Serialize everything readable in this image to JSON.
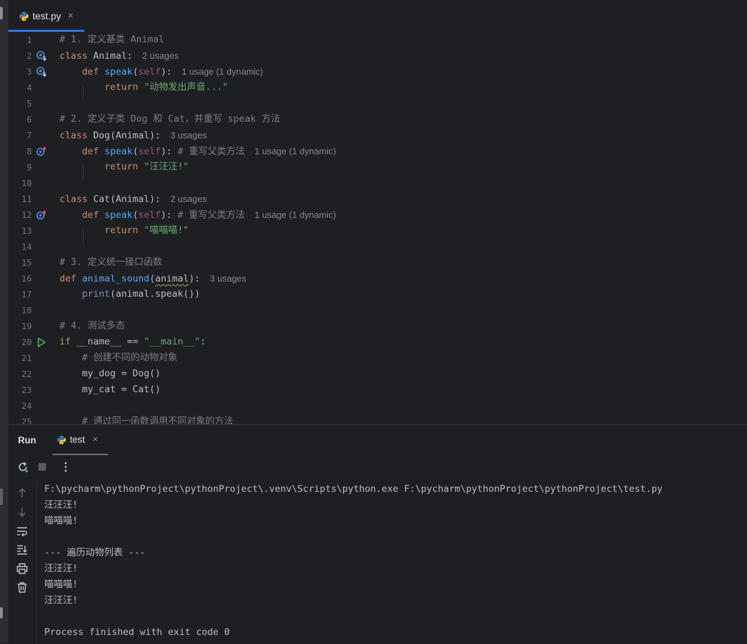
{
  "editor": {
    "tab": {
      "filename": "test.py",
      "close": "×"
    },
    "lines": [
      {
        "n": "1"
      },
      {
        "n": "2"
      },
      {
        "n": "3"
      },
      {
        "n": "4"
      },
      {
        "n": "5"
      },
      {
        "n": "6"
      },
      {
        "n": "7"
      },
      {
        "n": "8"
      },
      {
        "n": "9"
      },
      {
        "n": "10"
      },
      {
        "n": "11"
      },
      {
        "n": "12"
      },
      {
        "n": "13"
      },
      {
        "n": "14"
      },
      {
        "n": "15"
      },
      {
        "n": "16"
      },
      {
        "n": "17"
      },
      {
        "n": "18"
      },
      {
        "n": "19"
      },
      {
        "n": "20"
      },
      {
        "n": "21"
      },
      {
        "n": "22"
      },
      {
        "n": "23"
      },
      {
        "n": "24"
      },
      {
        "n": "25"
      }
    ],
    "code": {
      "l1_comment": "# 1. 定义基类 Animal",
      "l2_kw": "class",
      "l2_rest": " Animal:",
      "l2_hint": "2 usages",
      "l3_kw": "def",
      "l3_fn": "speak",
      "l3_self": "self",
      "l3_hint": "1 usage (1 dynamic)",
      "l4_kw": "return",
      "l4_str": "\"动物发出声音...\"",
      "l6_comment": "# 2. 定义子类 Dog 和 Cat，并重写 speak 方法",
      "l7_kw": "class",
      "l7_rest": " Dog(Animal):",
      "l7_hint": "3 usages",
      "l8_kw": "def",
      "l8_fn": "speak",
      "l8_self": "self",
      "l8_comment": "# 重写父类方法",
      "l8_hint": "1 usage (1 dynamic)",
      "l9_kw": "return",
      "l9_str": "\"汪汪汪!\"",
      "l11_kw": "class",
      "l11_rest": " Cat(Animal):",
      "l11_hint": "2 usages",
      "l12_kw": "def",
      "l12_fn": "speak",
      "l12_self": "self",
      "l12_comment": "# 重写父类方法",
      "l12_hint": "1 usage (1 dynamic)",
      "l13_kw": "return",
      "l13_str": "\"喵喵喵!\"",
      "l15_comment": "# 3. 定义统一接口函数",
      "l16_kw": "def",
      "l16_fn": "animal_sound",
      "l16_param": "animal",
      "l16_hint": "3 usages",
      "l17_print": "print",
      "l17_rest": "(animal.speak())",
      "l19_comment": "# 4. 测试多态",
      "l20_kw": "if",
      "l20_mid": " __name__ == ",
      "l20_str": "\"__main__\"",
      "l21_comment": "# 创建不同的动物对象",
      "l22": "my_dog = Dog()",
      "l23": "my_cat = Cat()",
      "l25_comment": "# 通过同一函数调用不同对象的方法"
    }
  },
  "run_panel": {
    "title": "Run",
    "tab_label": "test",
    "tab_close": "×",
    "console": [
      "F:\\pycharm\\pythonProject\\pythonProject\\.venv\\Scripts\\python.exe F:\\pycharm\\pythonProject\\pythonProject\\test.py",
      "汪汪汪!",
      "喵喵喵!",
      "",
      "--- 遍历动物列表 ---",
      "汪汪汪!",
      "喵喵喵!",
      "汪汪汪!",
      "",
      "Process finished with exit code 0"
    ]
  },
  "colors": {
    "keyword": "#cf8e6d",
    "function": "#56a8f5",
    "self": "#94558d",
    "string": "#6aab73",
    "comment": "#7a7e85",
    "accent": "#3574f0",
    "run_green": "#5fb865"
  }
}
